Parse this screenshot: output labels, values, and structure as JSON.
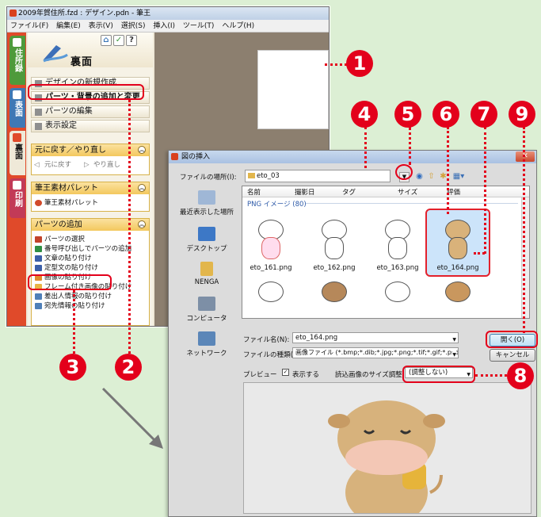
{
  "app": {
    "title": "2009年賀住所.fzd : デザイン.pdn - 筆王",
    "menu": [
      "ファイル(F)",
      "編集(E)",
      "表示(V)",
      "選択(S)",
      "挿入(I)",
      "ツール(T)",
      "ヘルプ(H)"
    ],
    "side_tabs": [
      "住所録",
      "表面",
      "裏面",
      "印刷"
    ],
    "panel_title": "裏面",
    "menu_items": [
      "デザインの新規作成",
      "パーツ・背景の追加と変更",
      "パーツの編集",
      "表示設定"
    ],
    "sections": {
      "undo": {
        "title": "元に戻す／やり直し",
        "items": [
          "元に戻す",
          "やり直し"
        ]
      },
      "material": {
        "title": "筆王素材パレット",
        "items": [
          "筆王素材パレット"
        ]
      },
      "add_parts": {
        "title": "パーツの追加",
        "items": [
          "パーツの選択",
          "番号呼び出しでパーツの追加",
          "文章の貼り付け",
          "定型文の貼り付け",
          "画像の貼り付け",
          "フレーム付き画像の貼り付け",
          "差出人情報の貼り付け",
          "宛先情報の貼り付け"
        ]
      }
    }
  },
  "dialog": {
    "title": "図の挿入",
    "close": "✕",
    "location_label": "ファイルの場所(I):",
    "location_value": "eto_03",
    "columns": [
      "名前",
      "撮影日",
      "タグ",
      "サイズ",
      "評価"
    ],
    "group_label": "PNG イメージ (80)",
    "places": [
      "最近表示した場所",
      "デスクトップ",
      "NENGA",
      "コンピュータ",
      "ネットワーク"
    ],
    "files": [
      "eto_161.png",
      "eto_162.png",
      "eto_163.png",
      "eto_164.png"
    ],
    "filename_label": "ファイル名(N):",
    "filename_value": "eto_164.png",
    "filetype_label": "ファイルの種類(T):",
    "filetype_value": "画像ファイル (*.bmp;*.dib;*.jpg;*.png;*.tif;*.gif;*.psd;*.fp",
    "open_button": "開く(O)",
    "cancel_button": "キャンセル",
    "preview_label": "プレビュー",
    "show_label": "表示する",
    "size_label": "読込画像のサイズ調整:",
    "size_value": "(調整しない)"
  },
  "callouts": [
    "1",
    "2",
    "3",
    "4",
    "5",
    "6",
    "7",
    "8",
    "9"
  ],
  "colors": {
    "accent": "#e3001b",
    "background": "#dcefd4",
    "selection": "#cce4fa"
  }
}
